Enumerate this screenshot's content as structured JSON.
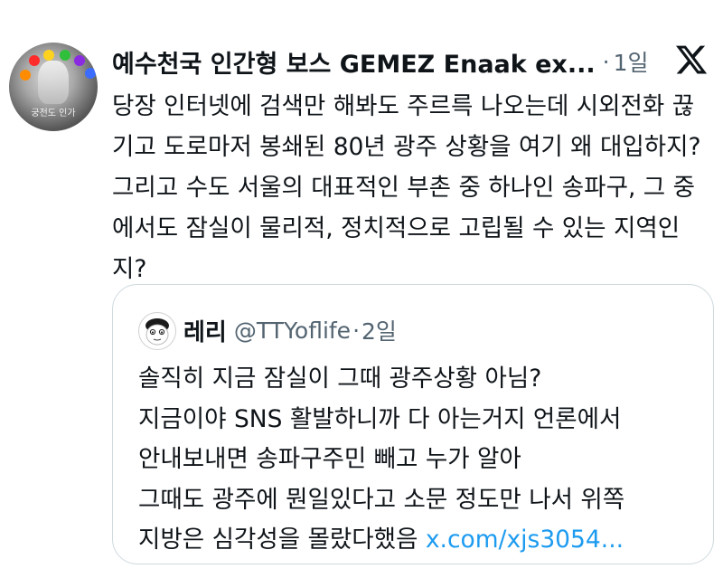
{
  "tweet": {
    "author_name": "예수천국 인간형 보스 GEMEZ Enaak ex...",
    "separator": "·",
    "time": "1일",
    "avatar_caption": "궁전도 인가",
    "body": "당장 인터넷에 검색만 해봐도 주르륵 나오는데 시외전화 끊기고 도로마저 봉쇄된 80년 광주 상황을 여기 왜 대입하지? 그리고 수도 서울의 대표적인 부촌 중 하나인 송파구, 그 중에서도 잠실이 물리적, 정치적으로 고립될 수 있는 지역인지?"
  },
  "quoted": {
    "name": "레리",
    "handle": "@TTYoflife",
    "separator": "·",
    "time": "2일",
    "lines": [
      "솔직히 지금 잠실이 그때 광주상황 아님?",
      "지금이야 SNS 활발하니까 다 아는거지 언론에서",
      "안내보내면 송파구주민 빼고 누가 알아",
      "그때도 광주에 뭔일있다고 소문 정도만 나서 위쪽",
      "지방은 심각성을 몰랐다했음 "
    ],
    "link": "x.com/xjs3054..."
  },
  "icons": {
    "platform": "x-logo-icon"
  },
  "colors": {
    "text": "#0f1419",
    "secondary": "#536471",
    "link": "#1d9bf0",
    "border": "#cfd9de"
  }
}
